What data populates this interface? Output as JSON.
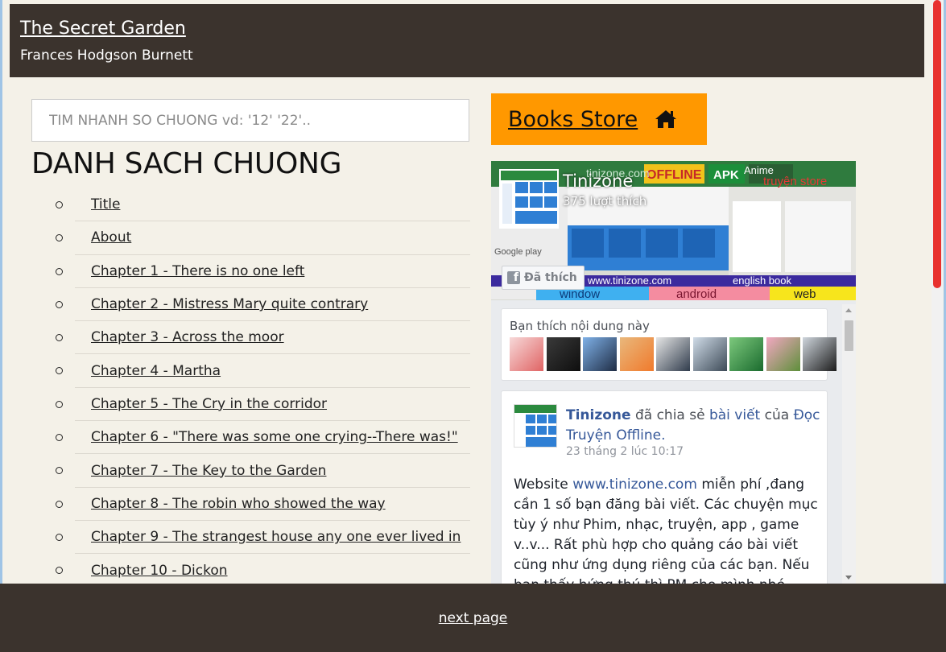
{
  "header": {
    "title": "The Secret Garden",
    "author": "Frances Hodgson Burnett"
  },
  "search": {
    "placeholder": "TIM NHANH SO CHUONG vd: '12' '22'.."
  },
  "list": {
    "title": "DANH SACH CHUONG",
    "items": [
      "Title",
      "About",
      "Chapter 1 - There is no one left",
      "Chapter 2 - Mistress Mary quite contrary",
      "Chapter 3 - Across the moor",
      "Chapter 4 - Martha",
      "Chapter 5 - The Cry in the corridor",
      "Chapter 6 - \"There was some one crying--There was!\"",
      "Chapter 7 - The Key to the Garden",
      "Chapter 8 - The robin who showed the way",
      "Chapter 9 - The strangest house any one ever lived in",
      "Chapter 10 - Dickon"
    ]
  },
  "store": {
    "label": "Books Store",
    "icon": "home-icon"
  },
  "facebook": {
    "page_name": "Tinizone",
    "likes": "375 lượt thích",
    "liked_button": "Đã thích",
    "friends_caption": "Bạn thích nội dung này",
    "cover": {
      "brand": "tinizone.com",
      "top_text_1": "OFFLINE",
      "top_text_2": "APK",
      "top_text_3": "Anime",
      "top_text_4": "truyện store",
      "url_text": "www.tinizone.com",
      "tag_1": "english book",
      "tag_2": "window",
      "tag_3": "android",
      "tag_4": "web",
      "store_text": "Google play"
    },
    "post": {
      "author": "Tinizone",
      "shared_text": "đã chia sẻ",
      "link_post": "bài viết",
      "of_text": "của",
      "source": "Đọc Truyện Offline.",
      "time": "23 tháng 2 lúc 10:17",
      "body_prefix": "Website",
      "body_link": "www.tinizone.com",
      "body_text": "miễn phí ,đang cần 1 số bạn đăng bài viết. Các chuyện mục tùy ý như Phim, nhạc, truyện, app , game v..v... Rất phù hợp cho quảng cáo bài viết cũng như ứng dụng riêng của các bạn. Nếu bạn thấy hứng thú thì PM cho mình nhé."
    }
  },
  "footer": {
    "next_label": "next page"
  },
  "colors": {
    "header_bg": "#3b332d",
    "page_bg": "#f4f1e8",
    "store_bg": "#ff9800",
    "fb_link": "#365899",
    "scroll_thumb": "#e8312f"
  }
}
